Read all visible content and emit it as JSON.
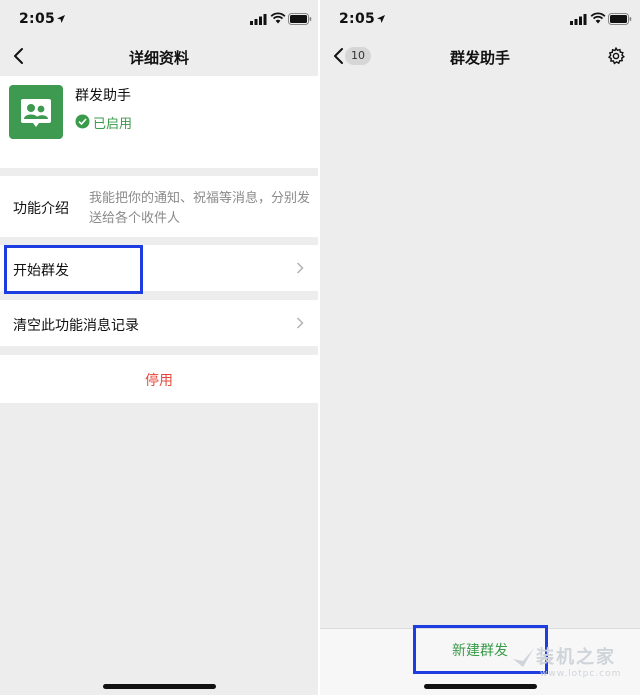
{
  "left": {
    "status": {
      "time": "2:05"
    },
    "nav": {
      "title": "详细资料"
    },
    "app": {
      "name": "群发助手",
      "status": "已启用"
    },
    "intro": {
      "label": "功能介绍",
      "desc": "我能把你的通知、祝福等消息，分别发送给各个收件人"
    },
    "menu": {
      "start": "开始群发",
      "clear": "清空此功能消息记录"
    },
    "disable": "停用"
  },
  "right": {
    "status": {
      "time": "2:05"
    },
    "nav": {
      "title": "群发助手",
      "back_count": "10"
    },
    "new_broadcast": "新建群发"
  },
  "watermark": {
    "title": "装机之家",
    "url": "www.lotpc.com"
  },
  "colors": {
    "accent_green": "#3a9b4a",
    "danger_red": "#e5483a",
    "highlight_blue": "#1e3de0"
  },
  "icons": [
    "location-arrow-icon",
    "signal-icon",
    "wifi-icon",
    "battery-icon",
    "back-chevron-icon",
    "group-chat-icon",
    "check-circle-icon",
    "chevron-right-icon",
    "gear-icon"
  ]
}
